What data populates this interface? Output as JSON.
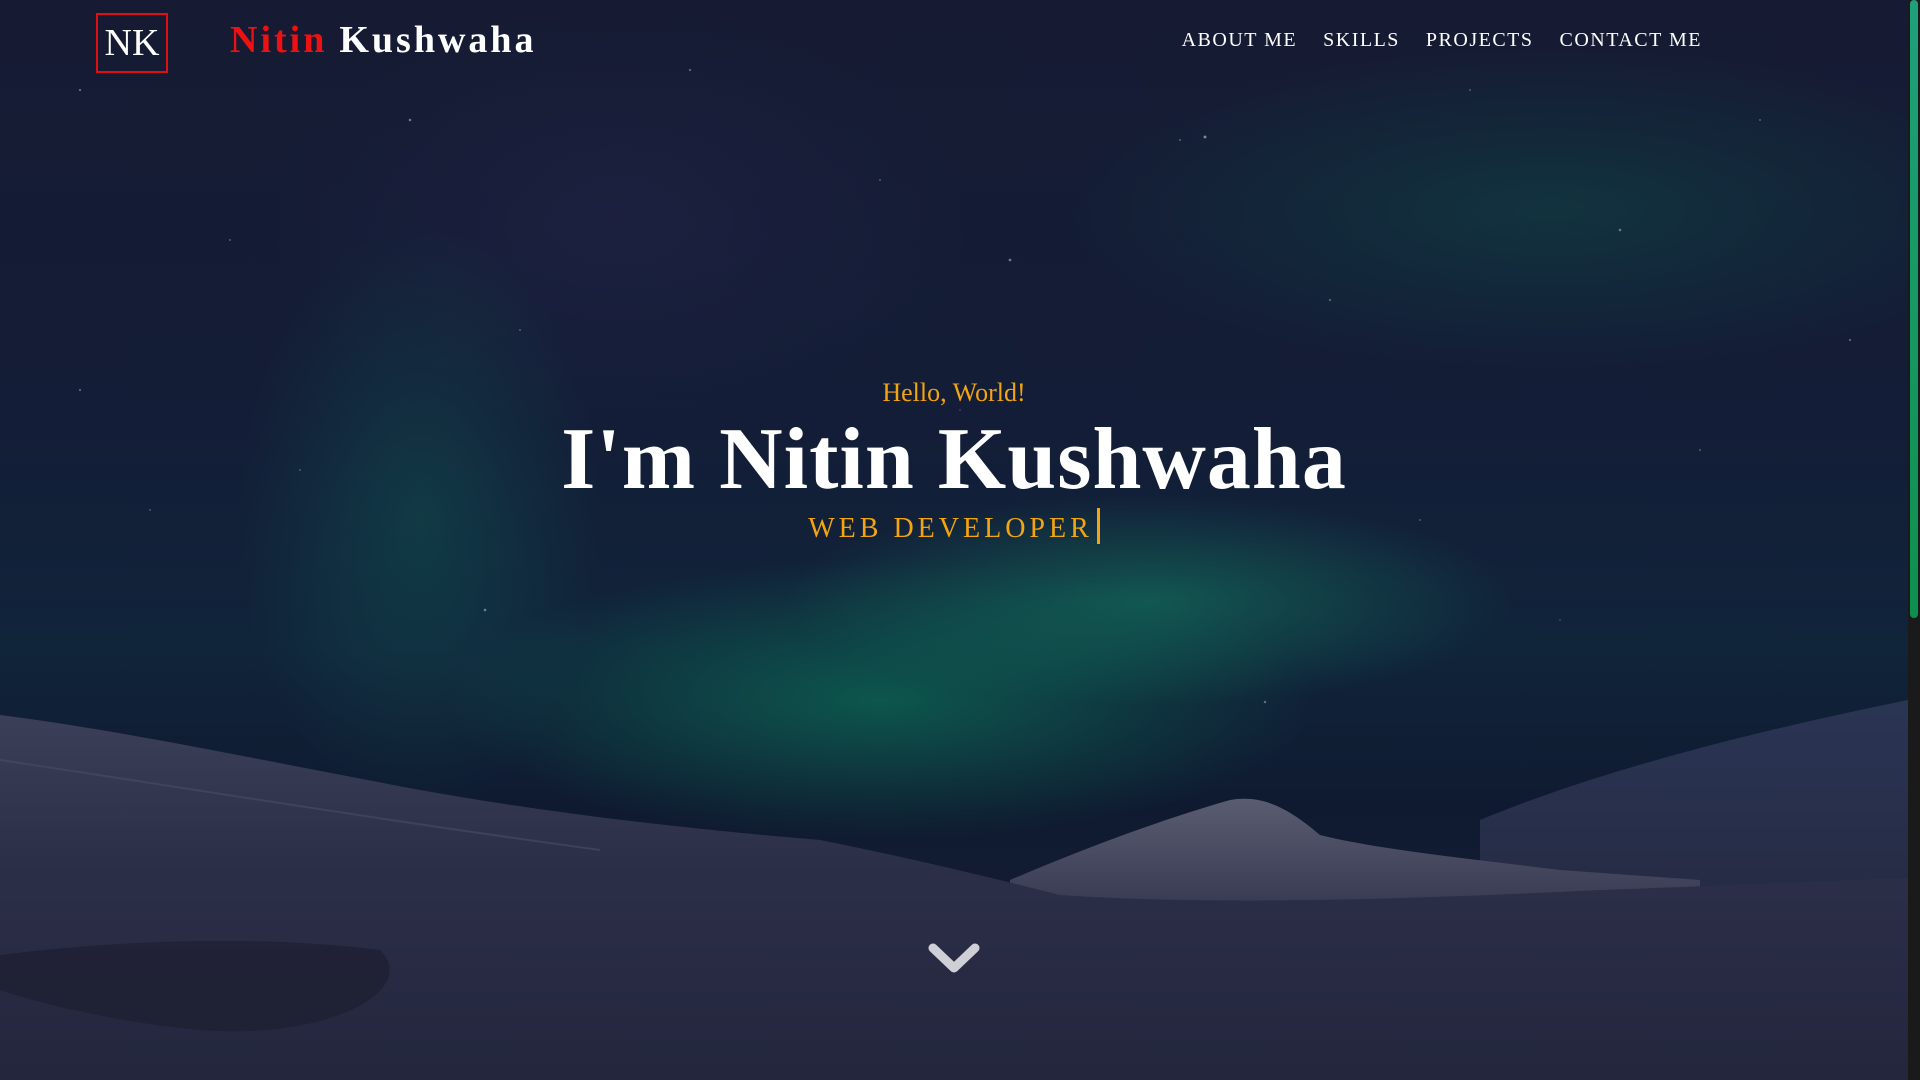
{
  "nav": {
    "logo_initials": "NK",
    "brand_first": "Nitin",
    "brand_last": "Kushwaha",
    "menu": [
      {
        "label": "ABOUT ME"
      },
      {
        "label": "SKILLS"
      },
      {
        "label": "PROJECTS"
      },
      {
        "label": "CONTACT ME"
      }
    ]
  },
  "hero": {
    "greeting": "Hello, World!",
    "title": "I'm Nitin Kushwaha",
    "role": "WEB DEVELOPER",
    "scroll_icon": "chevron-down-icon"
  },
  "colors": {
    "accent_gold": "#f2a511",
    "brand_red": "#ee1111",
    "scroll_thumb": "#1fa07a"
  }
}
